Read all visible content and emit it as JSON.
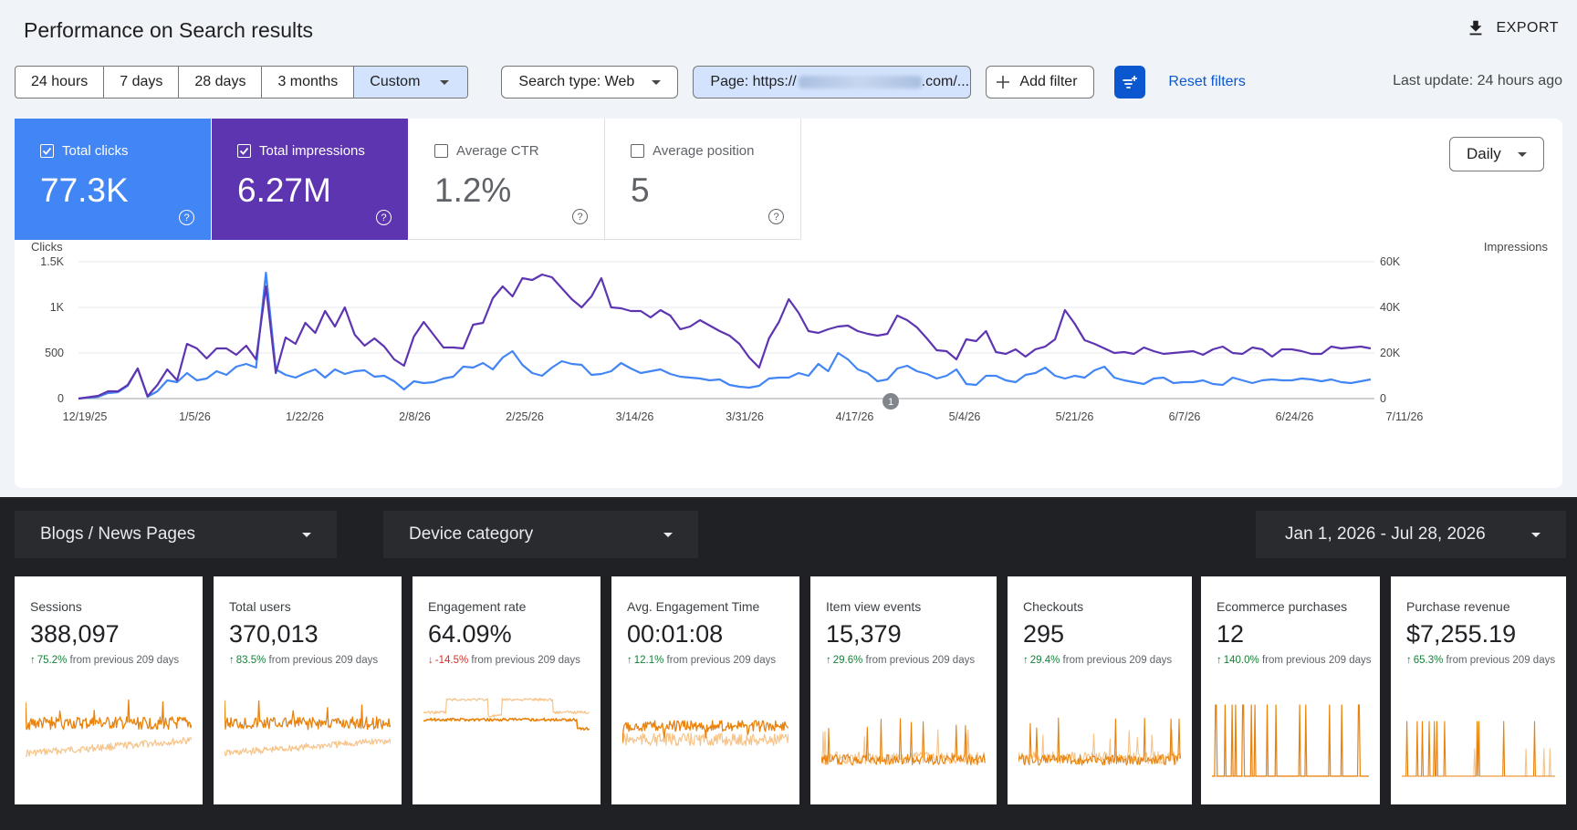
{
  "header": {
    "title": "Performance on Search results",
    "export_label": "EXPORT"
  },
  "date_ranges": [
    "24 hours",
    "7 days",
    "28 days",
    "3 months"
  ],
  "selected_range": "Custom",
  "filters": {
    "search_type": "Search type: Web",
    "page_prefix": "Page: https://",
    "page_suffix": ".com/...",
    "add_filter": "Add filter",
    "reset": "Reset filters"
  },
  "last_update": "Last update: 24 hours ago",
  "metrics": {
    "clicks": {
      "label": "Total clicks",
      "value": "77.3K",
      "checked": true
    },
    "impressions": {
      "label": "Total impressions",
      "value": "6.27M",
      "checked": true
    },
    "ctr": {
      "label": "Average CTR",
      "value": "1.2%",
      "checked": false
    },
    "position": {
      "label": "Average position",
      "value": "5",
      "checked": false
    }
  },
  "granularity": "Daily",
  "colors": {
    "clicks": "#4285f4",
    "impressions": "#5e35b1",
    "accent": "#0b57d0",
    "spark": "#e8820c",
    "spark_prev": "#f6c48a"
  },
  "chart_data": {
    "type": "line",
    "left_axis": {
      "title": "Clicks",
      "ticks": [
        "0",
        "500",
        "1K",
        "1.5K"
      ],
      "range": [
        0,
        1500
      ]
    },
    "right_axis": {
      "title": "Impressions",
      "ticks": [
        "0",
        "20K",
        "40K",
        "60K"
      ],
      "range": [
        0,
        60000
      ]
    },
    "x_tick_labels": [
      "12/19/25",
      "1/5/26",
      "1/22/26",
      "2/8/26",
      "2/25/26",
      "3/14/26",
      "3/31/26",
      "4/17/26",
      "5/4/26",
      "5/21/26",
      "6/7/26",
      "6/24/26",
      "7/11/26"
    ],
    "annotation": "1",
    "series": [
      {
        "name": "Total clicks",
        "axis": "left",
        "values": [
          0,
          10,
          20,
          60,
          70,
          140,
          330,
          20,
          80,
          200,
          180,
          280,
          200,
          220,
          300,
          260,
          350,
          380,
          340,
          1380,
          320,
          260,
          230,
          280,
          320,
          230,
          320,
          270,
          300,
          310,
          240,
          250,
          190,
          100,
          190,
          170,
          180,
          220,
          240,
          350,
          340,
          390,
          320,
          450,
          520,
          370,
          280,
          250,
          340,
          410,
          380,
          370,
          260,
          270,
          300,
          390,
          330,
          280,
          300,
          320,
          270,
          240,
          230,
          220,
          200,
          210,
          150,
          130,
          120,
          140,
          220,
          230,
          230,
          280,
          250,
          380,
          300,
          500,
          430,
          320,
          280,
          190,
          210,
          330,
          360,
          300,
          270,
          220,
          250,
          320,
          160,
          150,
          250,
          250,
          200,
          180,
          260,
          280,
          340,
          250,
          220,
          250,
          230,
          310,
          350,
          230,
          200,
          180,
          160,
          220,
          230,
          170,
          180,
          180,
          200,
          160,
          150,
          230,
          200,
          170,
          200,
          210,
          200,
          200,
          220,
          210,
          190,
          210,
          180,
          170,
          190,
          210
        ]
      },
      {
        "name": "Total impressions",
        "axis": "right",
        "values": [
          0,
          600,
          1200,
          3200,
          3200,
          6000,
          13200,
          1000,
          6000,
          12800,
          8000,
          24000,
          22000,
          17600,
          22000,
          22000,
          19200,
          23200,
          17200,
          49200,
          11200,
          26800,
          24000,
          33200,
          28800,
          38400,
          31600,
          40000,
          28000,
          23200,
          26400,
          22800,
          17200,
          14400,
          27200,
          33600,
          28000,
          22400,
          22400,
          22000,
          32400,
          33200,
          44000,
          49200,
          44800,
          52800,
          52000,
          54400,
          53200,
          48400,
          43600,
          40000,
          44800,
          52800,
          40000,
          39600,
          38400,
          38400,
          35600,
          38800,
          36400,
          30400,
          31600,
          34400,
          32000,
          29600,
          27600,
          24000,
          18000,
          13600,
          26400,
          33600,
          43600,
          37600,
          29600,
          28800,
          30400,
          31600,
          32000,
          29600,
          28400,
          27600,
          28400,
          36400,
          34400,
          31200,
          26400,
          21200,
          20800,
          17200,
          26000,
          25200,
          29600,
          20400,
          19600,
          21600,
          18400,
          21600,
          22800,
          26000,
          38800,
          32800,
          25600,
          24000,
          22000,
          20000,
          20400,
          19600,
          22400,
          20800,
          19600,
          20000,
          20400,
          20800,
          19200,
          21600,
          22800,
          20000,
          19600,
          22400,
          21600,
          18400,
          21600,
          21600,
          20800,
          19600,
          19600,
          22800,
          22000,
          22400,
          22800,
          22000
        ]
      }
    ]
  },
  "ga": {
    "filter_pages": "Blogs / News Pages",
    "filter_device": "Device category",
    "date_range": "Jan 1, 2026 - Jul 28, 2026",
    "kpis": [
      {
        "label": "Sessions",
        "value": "388,097",
        "delta": "75.2%",
        "dir": "up",
        "suffix": "from previous 209 days"
      },
      {
        "label": "Total users",
        "value": "370,013",
        "delta": "83.5%",
        "dir": "up",
        "suffix": "from previous 209 days"
      },
      {
        "label": "Engagement rate",
        "value": "64.09%",
        "delta": "-14.5%",
        "dir": "down",
        "suffix": "from previous 209 days"
      },
      {
        "label": "Avg. Engagement Time",
        "value": "00:01:08",
        "delta": "12.1%",
        "dir": "up",
        "suffix": "from previous 209 days"
      },
      {
        "label": "Item view events",
        "value": "15,379",
        "delta": "29.6%",
        "dir": "up",
        "suffix": "from previous 209 days"
      },
      {
        "label": "Checkouts",
        "value": "295",
        "delta": "29.4%",
        "dir": "up",
        "suffix": "from previous 209 days"
      },
      {
        "label": "Ecommerce purchases",
        "value": "12",
        "delta": "140.0%",
        "dir": "up",
        "suffix": "from previous 209 days"
      },
      {
        "label": "Purchase revenue",
        "value": "$7,255.19",
        "delta": "65.3%",
        "dir": "up",
        "suffix": "from previous 209 days"
      }
    ]
  }
}
